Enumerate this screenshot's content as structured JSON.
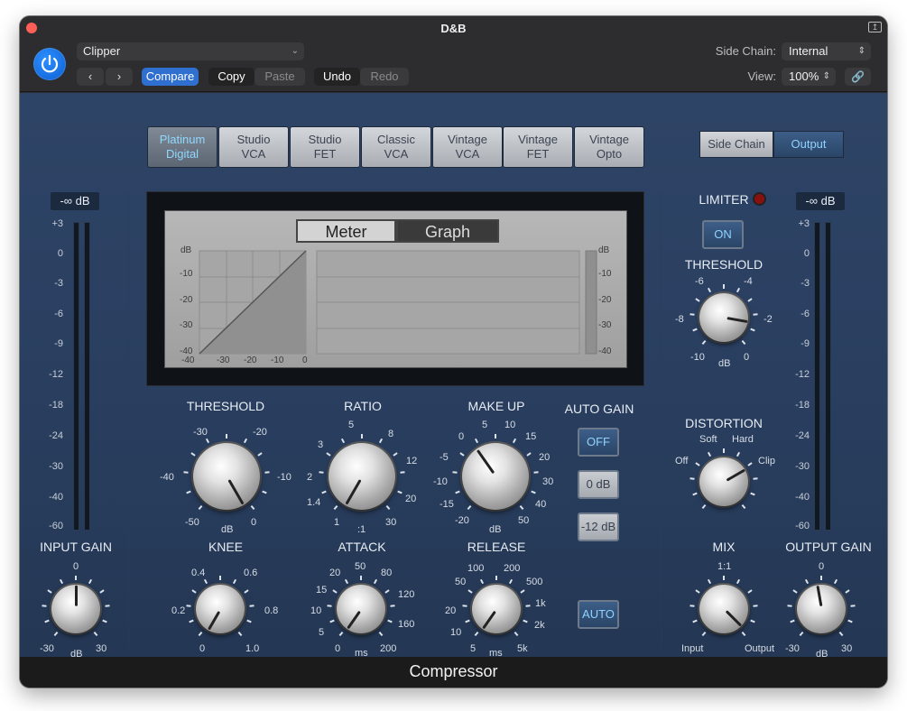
{
  "window": {
    "title": "D&B",
    "footer": "Compressor"
  },
  "header": {
    "preset": "Clipper",
    "compare": "Compare",
    "copy": "Copy",
    "paste": "Paste",
    "undo": "Undo",
    "redo": "Redo",
    "side_chain_label": "Side Chain:",
    "side_chain_value": "Internal",
    "view_label": "View:",
    "view_value": "100%"
  },
  "models": [
    "Platinum Digital",
    "Studio VCA",
    "Studio FET",
    "Classic VCA",
    "Vintage VCA",
    "Vintage FET",
    "Vintage Opto"
  ],
  "models_lines": [
    [
      "Platinum",
      "Digital"
    ],
    [
      "Studio",
      "VCA"
    ],
    [
      "Studio",
      "FET"
    ],
    [
      "Classic",
      "VCA"
    ],
    [
      "Vintage",
      "VCA"
    ],
    [
      "Vintage",
      "FET"
    ],
    [
      "Vintage",
      "Opto"
    ]
  ],
  "selected_model": "Platinum Digital",
  "view_toggle": {
    "side_chain": "Side Chain",
    "output": "Output",
    "selected": "Output"
  },
  "meters": {
    "input_readout": "-∞ dB",
    "output_readout": "-∞ dB",
    "scale": [
      "+3",
      "0",
      "-3",
      "-6",
      "-9",
      "-12",
      "-18",
      "-24",
      "-30",
      "-40",
      "-60"
    ]
  },
  "display": {
    "meter_tab": "Meter",
    "graph_tab": "Graph",
    "selected_tab": "Meter",
    "left_db_label": "dB",
    "right_db_label": "dB",
    "y_ticks": [
      "-10",
      "-20",
      "-30",
      "-40"
    ],
    "x_ticks": [
      "-40",
      "-30",
      "-20",
      "-10",
      "0"
    ],
    "right_ticks": [
      "-10",
      "-20",
      "-30",
      "-40"
    ]
  },
  "threshold": {
    "label": "THRESHOLD",
    "ticks": [
      "-30",
      "-20",
      "-40",
      "-10",
      "-50",
      "0"
    ],
    "unit": "dB"
  },
  "ratio": {
    "label": "RATIO",
    "ticks": [
      "5",
      "3",
      "8",
      "2",
      "12",
      "1.4",
      "20",
      "1",
      "30"
    ],
    "unit": ":1"
  },
  "makeup": {
    "label": "MAKE UP",
    "ticks": [
      "5",
      "10",
      "0",
      "15",
      "-5",
      "20",
      "-10",
      "30",
      "-15",
      "40",
      "-20",
      "50"
    ],
    "unit": "dB"
  },
  "auto_gain": {
    "label": "AUTO GAIN",
    "off": "OFF",
    "zero": "0 dB",
    "minus12": "-12 dB",
    "selected": "OFF"
  },
  "knee": {
    "label": "KNEE",
    "ticks": [
      "0.4",
      "0.6",
      "0.2",
      "0.8",
      "0",
      "1.0"
    ]
  },
  "attack": {
    "label": "ATTACK",
    "ticks": [
      "50",
      "20",
      "80",
      "15",
      "120",
      "10",
      "160",
      "5",
      "200",
      "0"
    ],
    "unit": "ms"
  },
  "release": {
    "label": "RELEASE",
    "ticks": [
      "100",
      "200",
      "50",
      "500",
      "20",
      "1k",
      "10",
      "2k",
      "5",
      "5k"
    ],
    "unit": "ms"
  },
  "release_auto": "AUTO",
  "limiter": {
    "label": "LIMITER",
    "on": "ON",
    "threshold_label": "THRESHOLD",
    "ticks": [
      "-6",
      "-4",
      "-8",
      "-2",
      "-10",
      "0"
    ],
    "unit": "dB"
  },
  "distortion": {
    "label": "DISTORTION",
    "ticks": [
      "Soft",
      "Hard",
      "Off",
      "Clip"
    ],
    "value": "Hard"
  },
  "mix": {
    "label": "MIX",
    "ratio": "1:1",
    "left": "Input",
    "right": "Output"
  },
  "input_gain": {
    "label": "INPUT GAIN",
    "ticks": [
      "0",
      "-30",
      "30"
    ],
    "unit": "dB"
  },
  "output_gain": {
    "label": "OUTPUT GAIN",
    "ticks": [
      "0",
      "-30",
      "30"
    ],
    "unit": "dB"
  },
  "colors": {
    "accent": "#2f6fd0",
    "active_text": "#8fd2ff",
    "panel": "#2b3f60"
  }
}
